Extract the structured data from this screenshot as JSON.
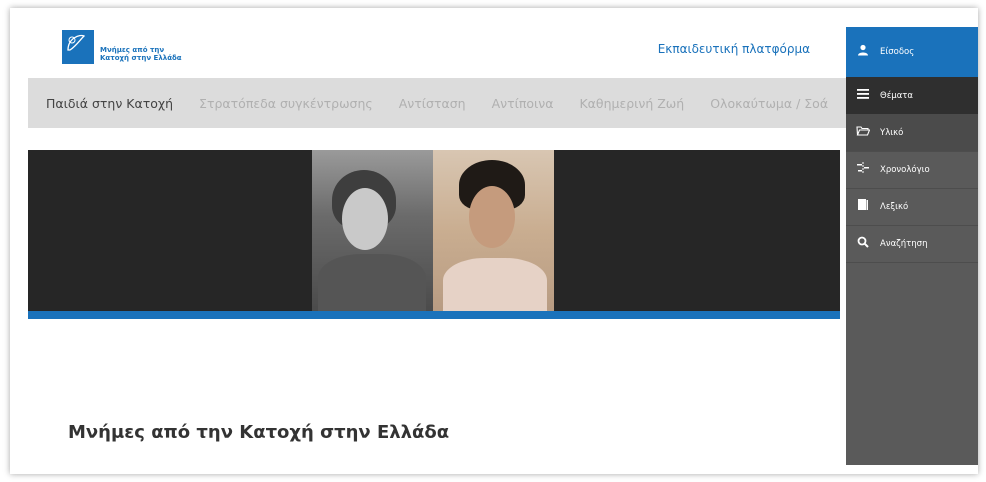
{
  "header": {
    "logo_text_line1": "Μνήμες από την",
    "logo_text_line2": "Κατοχή στην Ελλάδα",
    "platform_label": "Εκπαιδευτική πλατφόρμα"
  },
  "nav": {
    "items": [
      {
        "label": "Παιδιά στην Κατοχή"
      },
      {
        "label": "Στρατόπεδα συγκέντρωσης"
      },
      {
        "label": "Αντίσταση"
      },
      {
        "label": "Αντίποινα"
      },
      {
        "label": "Καθημερινή Ζωή"
      },
      {
        "label": "Ολοκαύτωμα / Σοά"
      }
    ]
  },
  "main": {
    "heading": "Μνήμες από την Κατοχή στην Ελλάδα"
  },
  "sidebar": {
    "login": {
      "label": "Είσοδος",
      "icon": "user-icon"
    },
    "items": [
      {
        "label": "Θέματα",
        "icon": "menu-icon"
      },
      {
        "label": "Υλικό",
        "icon": "folder-icon"
      },
      {
        "label": "Χρονολόγιο",
        "icon": "timeline-icon"
      },
      {
        "label": "Λεξικό",
        "icon": "book-icon"
      },
      {
        "label": "Αναζήτηση",
        "icon": "search-icon"
      }
    ]
  },
  "colors": {
    "accent": "#1a72bb",
    "sidebar_bg": "#5a5a5a",
    "nav_bg": "#dcdcdc",
    "hero_bg": "#262626"
  }
}
